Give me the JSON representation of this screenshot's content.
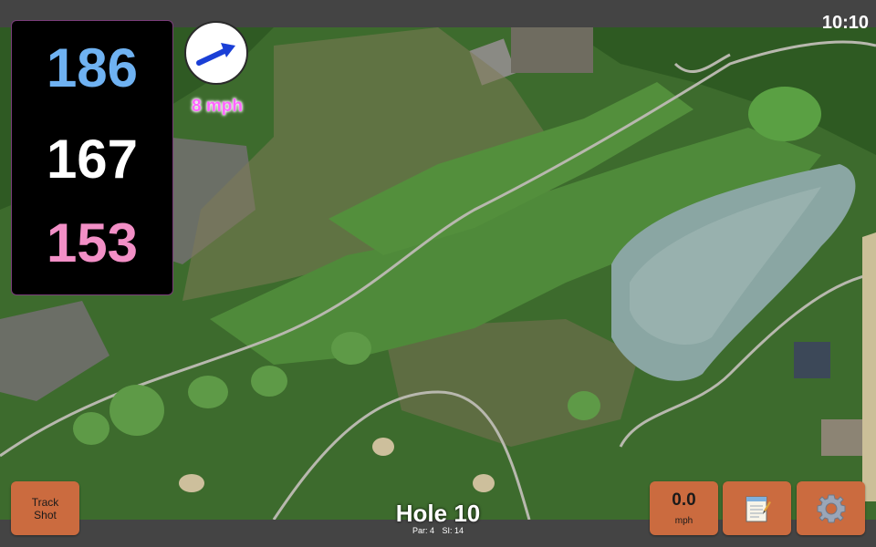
{
  "status": {
    "time": "10:10"
  },
  "distances": {
    "back": "186",
    "middle": "167",
    "front": "153"
  },
  "wind": {
    "speed": "8 mph",
    "icon": "wind-direction-arrow-icon"
  },
  "buttons": {
    "track_line1": "Track",
    "track_line2": "Shot",
    "speed_value": "0.0",
    "speed_unit": "mph",
    "notes_icon": "notepad-icon",
    "settings_icon": "gear-icon"
  },
  "hole": {
    "title": "Hole 10",
    "par": "Par: 4",
    "si": "SI: 14"
  },
  "colors": {
    "back_distance": "#6fb2f2",
    "middle_distance": "#ffffff",
    "front_distance": "#f28fc6",
    "button": "#cb6b3f",
    "wind_text": "#ff66ff"
  }
}
